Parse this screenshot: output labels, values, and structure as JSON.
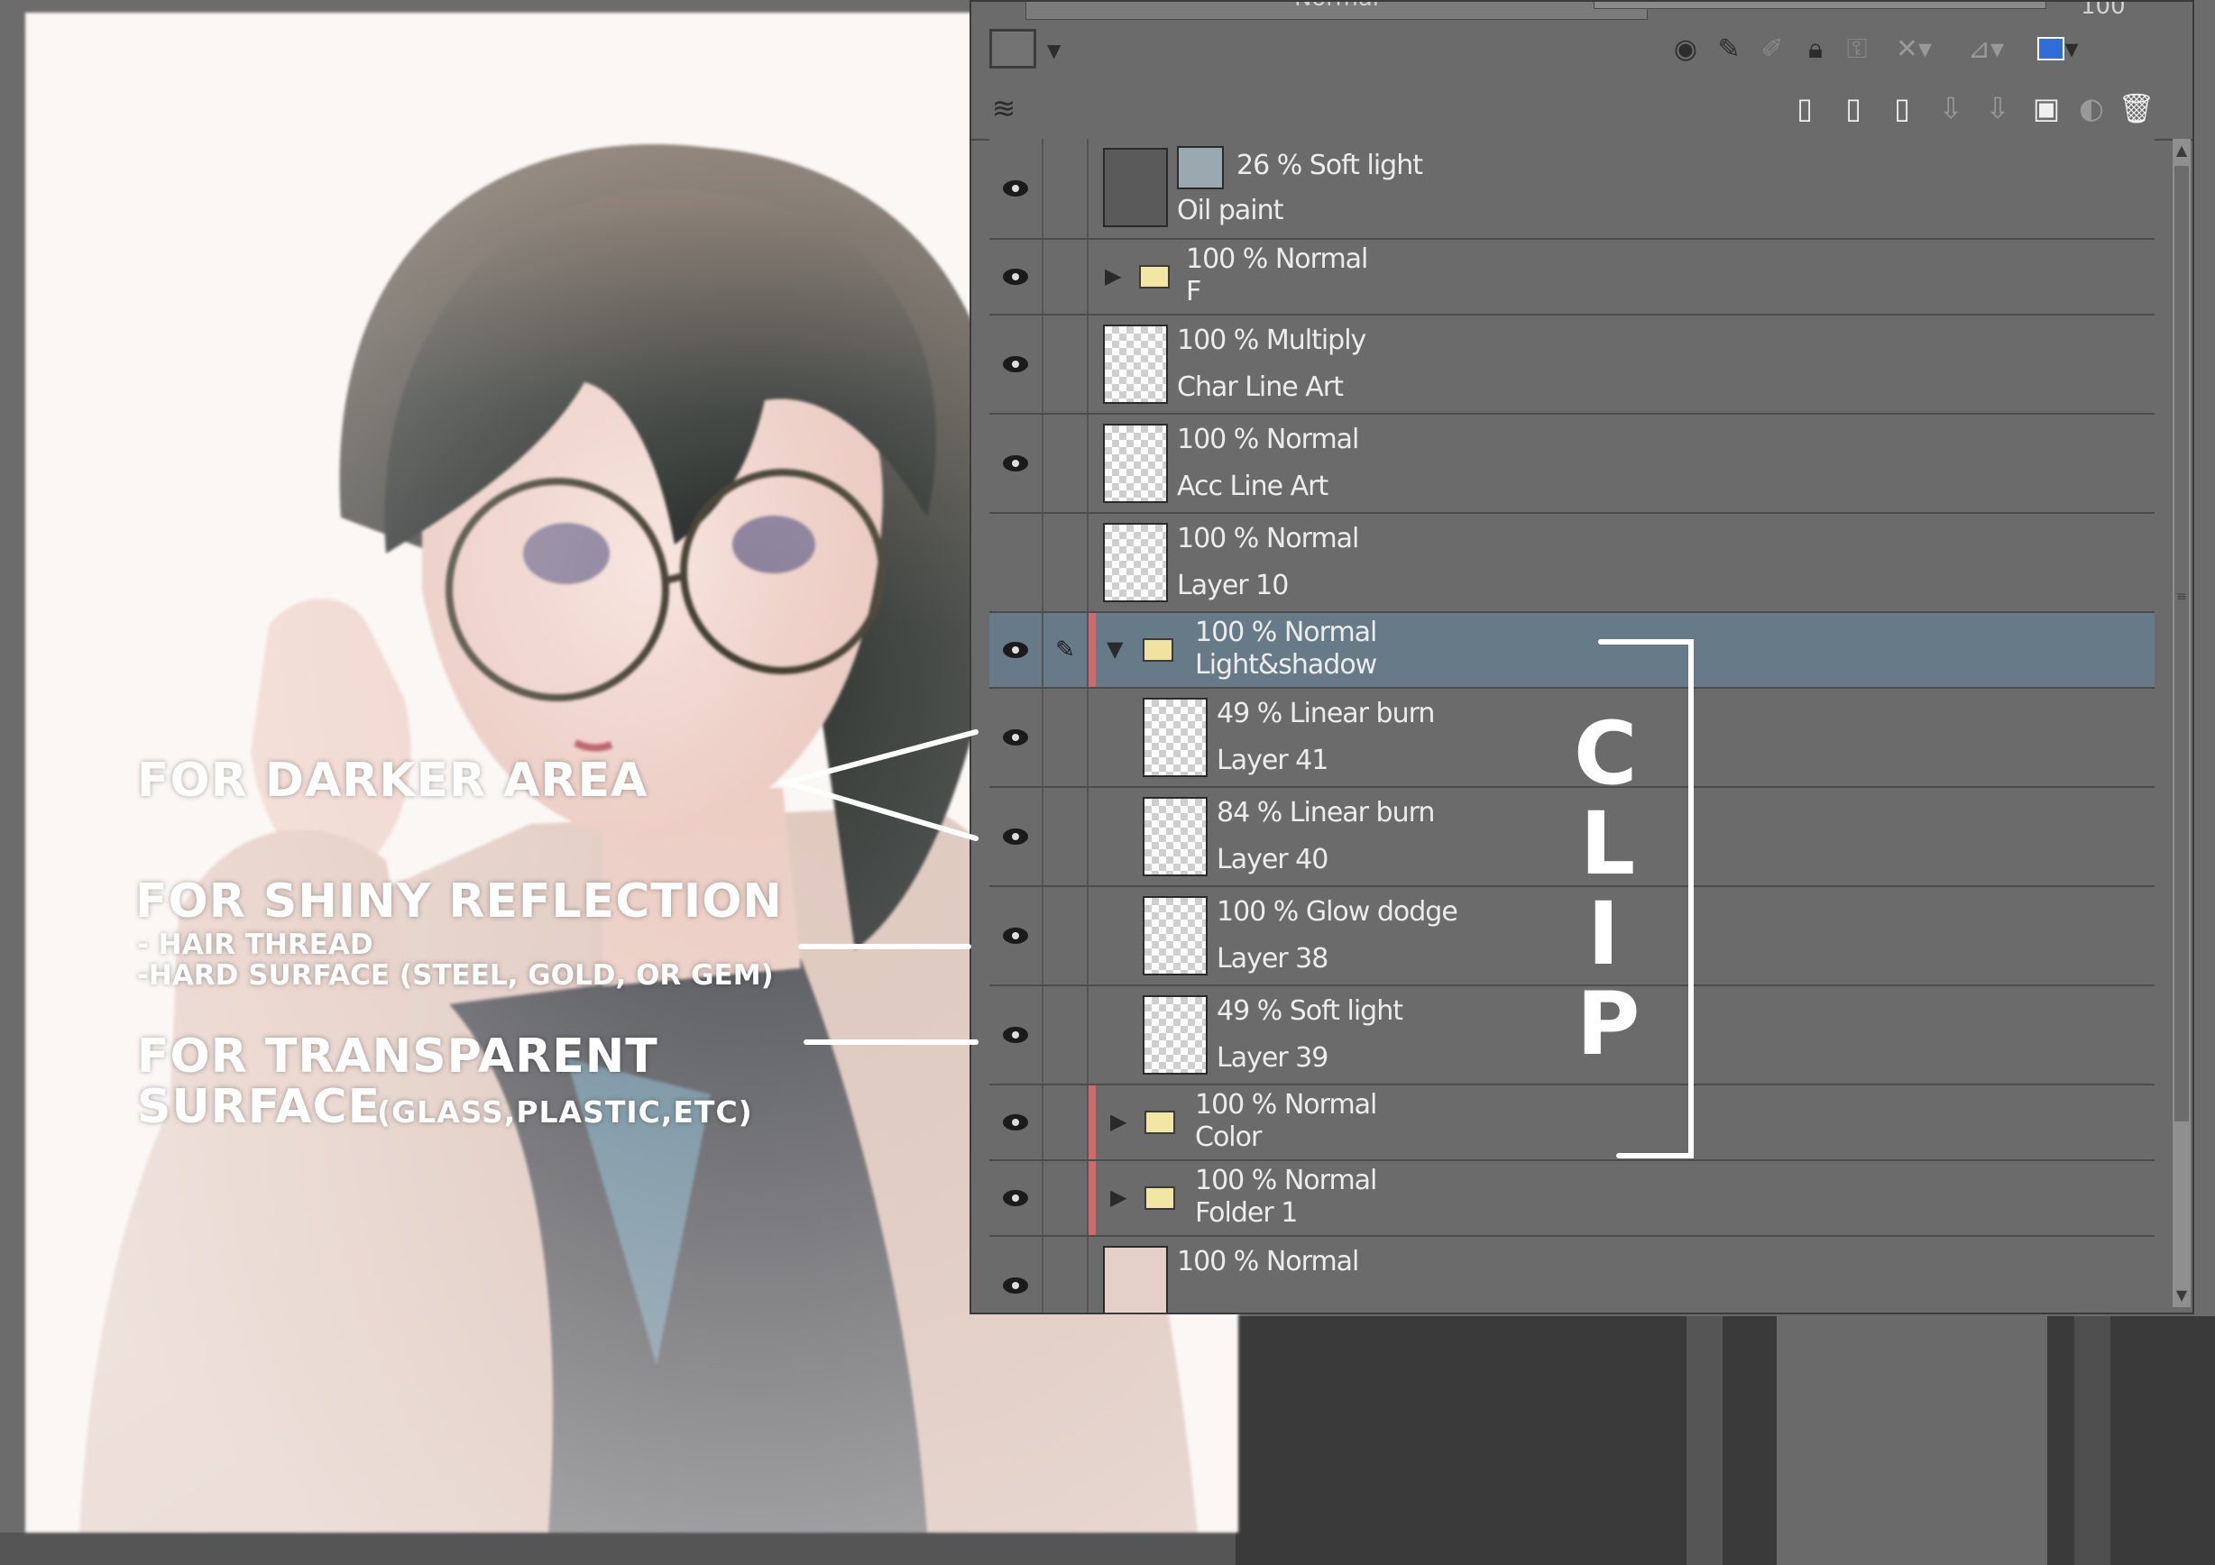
{
  "panel": {
    "blend_mode": "Normal",
    "opacity_value": "100",
    "toolbar": {
      "icons": [
        "color-swatch-icon",
        "ref-layer-icon",
        "draft-layer-icon",
        "lock-icon",
        "lock-transparent-icon",
        "mask-icon",
        "ruler-icon",
        "layer-color-icon"
      ]
    },
    "toolbar2": {
      "icons": [
        "layer-stack-icon",
        "new-raster-layer-icon",
        "new-vector-layer-icon",
        "new-folder-icon",
        "transfer-down-icon",
        "merge-down-icon",
        "layer-mask-icon",
        "apply-mask-icon",
        "delete-layer-icon"
      ]
    },
    "layers": [
      {
        "line1": "26 % Soft light",
        "line2": "Oil paint"
      },
      {
        "line1": "100 % Normal",
        "line2": "F"
      },
      {
        "line1": "100 % Multiply",
        "line2": "Char Line Art"
      },
      {
        "line1": "100 % Normal",
        "line2": "Acc Line Art"
      },
      {
        "line1": "100 % Normal",
        "line2": "Layer 10"
      },
      {
        "line1": "100 % Normal",
        "line2": "Light&shadow"
      },
      {
        "line1": "49 % Linear burn",
        "line2": "Layer 41"
      },
      {
        "line1": "84 % Linear burn",
        "line2": "Layer 40"
      },
      {
        "line1": "100 % Glow dodge",
        "line2": "Layer 38"
      },
      {
        "line1": "49 % Soft light",
        "line2": "Layer 39"
      },
      {
        "line1": "100 % Normal",
        "line2": "Color"
      },
      {
        "line1": "100 % Normal",
        "line2": "Folder 1"
      },
      {
        "line1": "100 % Normal",
        "line2": ""
      }
    ]
  },
  "annotations": {
    "darker": "For darker area",
    "shiny_title": "For shiny reflection",
    "shiny_sub1": "- hair thread",
    "shiny_sub2": "-hard surface (steel, gold, or gem)",
    "transparent_title1": "For transparent",
    "transparent_title2": "surface",
    "transparent_small": "(glass,plastic,etc)",
    "clip_letters": [
      "C",
      "L",
      "I",
      "P"
    ]
  },
  "colors": {
    "panel_bg": "#6b6b6b",
    "selected_row": "#667a88",
    "clip_mark": "#d06a6a",
    "annotation": "#ffffff"
  }
}
